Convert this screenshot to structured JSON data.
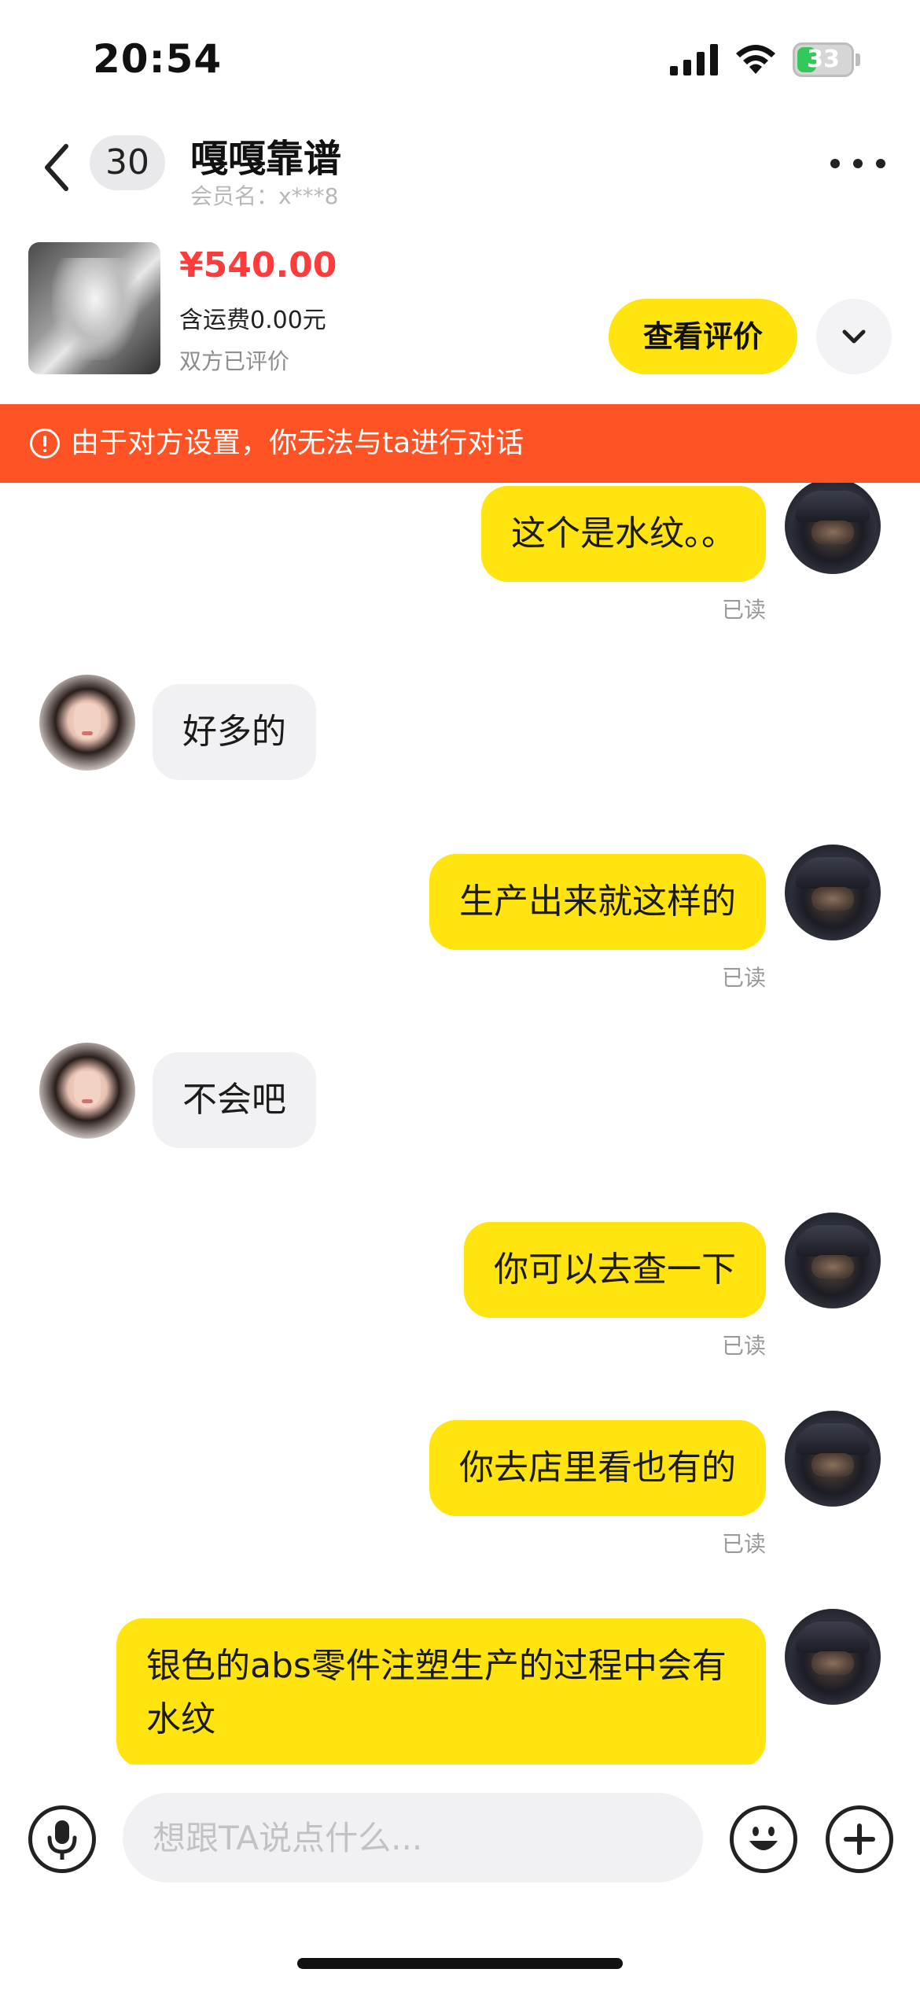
{
  "status_bar": {
    "time": "20:54",
    "battery": "33"
  },
  "header": {
    "unread_count": "30",
    "contact_name": "嘎嘎靠谱",
    "member_name": "会员名：x***8"
  },
  "product": {
    "price": "¥540.00",
    "shipping": "含运费0.00元",
    "review_status": "双方已评价",
    "review_button": "查看评价"
  },
  "warning": {
    "text": "由于对方设置，你无法与ta进行对话"
  },
  "messages": [
    {
      "sender": "me",
      "text": "这个是水纹。。",
      "read": "已读"
    },
    {
      "sender": "them",
      "text": "好多的"
    },
    {
      "sender": "me",
      "text": "生产出来就这样的",
      "read": "已读"
    },
    {
      "sender": "them",
      "text": "不会吧"
    },
    {
      "sender": "me",
      "text": "你可以去查一下",
      "read": "已读"
    },
    {
      "sender": "me",
      "text": "你去店里看也有的",
      "read": "已读"
    },
    {
      "sender": "me",
      "text": "银色的abs零件注塑生产的过程中会有水纹"
    }
  ],
  "input": {
    "placeholder": "想跟TA说点什么..."
  },
  "icons": {
    "back": "chevron-left-icon",
    "more": "more-dots-icon",
    "expand": "chevron-down-icon",
    "warning": "alert-circle-icon",
    "voice": "microphone-icon",
    "emoji": "smile-icon",
    "plus": "plus-icon"
  },
  "colors": {
    "accent_yellow": "#ffe40f",
    "warning_orange": "#ff5225",
    "price_red": "#ff3b3b"
  }
}
